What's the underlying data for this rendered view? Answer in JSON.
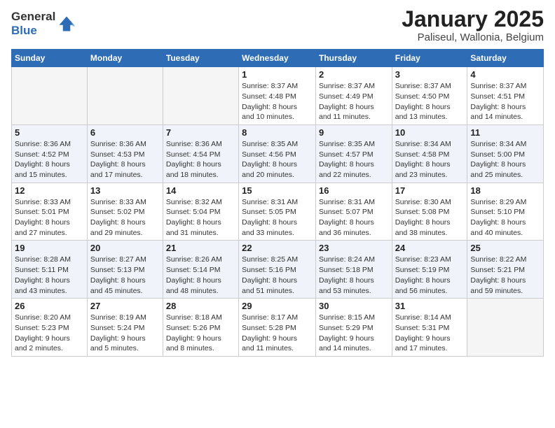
{
  "header": {
    "logo_general": "General",
    "logo_blue": "Blue",
    "title": "January 2025",
    "subtitle": "Paliseul, Wallonia, Belgium"
  },
  "weekdays": [
    "Sunday",
    "Monday",
    "Tuesday",
    "Wednesday",
    "Thursday",
    "Friday",
    "Saturday"
  ],
  "weeks": [
    [
      {
        "day": "",
        "info": ""
      },
      {
        "day": "",
        "info": ""
      },
      {
        "day": "",
        "info": ""
      },
      {
        "day": "1",
        "info": "Sunrise: 8:37 AM\nSunset: 4:48 PM\nDaylight: 8 hours\nand 10 minutes."
      },
      {
        "day": "2",
        "info": "Sunrise: 8:37 AM\nSunset: 4:49 PM\nDaylight: 8 hours\nand 11 minutes."
      },
      {
        "day": "3",
        "info": "Sunrise: 8:37 AM\nSunset: 4:50 PM\nDaylight: 8 hours\nand 13 minutes."
      },
      {
        "day": "4",
        "info": "Sunrise: 8:37 AM\nSunset: 4:51 PM\nDaylight: 8 hours\nand 14 minutes."
      }
    ],
    [
      {
        "day": "5",
        "info": "Sunrise: 8:36 AM\nSunset: 4:52 PM\nDaylight: 8 hours\nand 15 minutes."
      },
      {
        "day": "6",
        "info": "Sunrise: 8:36 AM\nSunset: 4:53 PM\nDaylight: 8 hours\nand 17 minutes."
      },
      {
        "day": "7",
        "info": "Sunrise: 8:36 AM\nSunset: 4:54 PM\nDaylight: 8 hours\nand 18 minutes."
      },
      {
        "day": "8",
        "info": "Sunrise: 8:35 AM\nSunset: 4:56 PM\nDaylight: 8 hours\nand 20 minutes."
      },
      {
        "day": "9",
        "info": "Sunrise: 8:35 AM\nSunset: 4:57 PM\nDaylight: 8 hours\nand 22 minutes."
      },
      {
        "day": "10",
        "info": "Sunrise: 8:34 AM\nSunset: 4:58 PM\nDaylight: 8 hours\nand 23 minutes."
      },
      {
        "day": "11",
        "info": "Sunrise: 8:34 AM\nSunset: 5:00 PM\nDaylight: 8 hours\nand 25 minutes."
      }
    ],
    [
      {
        "day": "12",
        "info": "Sunrise: 8:33 AM\nSunset: 5:01 PM\nDaylight: 8 hours\nand 27 minutes."
      },
      {
        "day": "13",
        "info": "Sunrise: 8:33 AM\nSunset: 5:02 PM\nDaylight: 8 hours\nand 29 minutes."
      },
      {
        "day": "14",
        "info": "Sunrise: 8:32 AM\nSunset: 5:04 PM\nDaylight: 8 hours\nand 31 minutes."
      },
      {
        "day": "15",
        "info": "Sunrise: 8:31 AM\nSunset: 5:05 PM\nDaylight: 8 hours\nand 33 minutes."
      },
      {
        "day": "16",
        "info": "Sunrise: 8:31 AM\nSunset: 5:07 PM\nDaylight: 8 hours\nand 36 minutes."
      },
      {
        "day": "17",
        "info": "Sunrise: 8:30 AM\nSunset: 5:08 PM\nDaylight: 8 hours\nand 38 minutes."
      },
      {
        "day": "18",
        "info": "Sunrise: 8:29 AM\nSunset: 5:10 PM\nDaylight: 8 hours\nand 40 minutes."
      }
    ],
    [
      {
        "day": "19",
        "info": "Sunrise: 8:28 AM\nSunset: 5:11 PM\nDaylight: 8 hours\nand 43 minutes."
      },
      {
        "day": "20",
        "info": "Sunrise: 8:27 AM\nSunset: 5:13 PM\nDaylight: 8 hours\nand 45 minutes."
      },
      {
        "day": "21",
        "info": "Sunrise: 8:26 AM\nSunset: 5:14 PM\nDaylight: 8 hours\nand 48 minutes."
      },
      {
        "day": "22",
        "info": "Sunrise: 8:25 AM\nSunset: 5:16 PM\nDaylight: 8 hours\nand 51 minutes."
      },
      {
        "day": "23",
        "info": "Sunrise: 8:24 AM\nSunset: 5:18 PM\nDaylight: 8 hours\nand 53 minutes."
      },
      {
        "day": "24",
        "info": "Sunrise: 8:23 AM\nSunset: 5:19 PM\nDaylight: 8 hours\nand 56 minutes."
      },
      {
        "day": "25",
        "info": "Sunrise: 8:22 AM\nSunset: 5:21 PM\nDaylight: 8 hours\nand 59 minutes."
      }
    ],
    [
      {
        "day": "26",
        "info": "Sunrise: 8:20 AM\nSunset: 5:23 PM\nDaylight: 9 hours\nand 2 minutes."
      },
      {
        "day": "27",
        "info": "Sunrise: 8:19 AM\nSunset: 5:24 PM\nDaylight: 9 hours\nand 5 minutes."
      },
      {
        "day": "28",
        "info": "Sunrise: 8:18 AM\nSunset: 5:26 PM\nDaylight: 9 hours\nand 8 minutes."
      },
      {
        "day": "29",
        "info": "Sunrise: 8:17 AM\nSunset: 5:28 PM\nDaylight: 9 hours\nand 11 minutes."
      },
      {
        "day": "30",
        "info": "Sunrise: 8:15 AM\nSunset: 5:29 PM\nDaylight: 9 hours\nand 14 minutes."
      },
      {
        "day": "31",
        "info": "Sunrise: 8:14 AM\nSunset: 5:31 PM\nDaylight: 9 hours\nand 17 minutes."
      },
      {
        "day": "",
        "info": ""
      }
    ]
  ]
}
